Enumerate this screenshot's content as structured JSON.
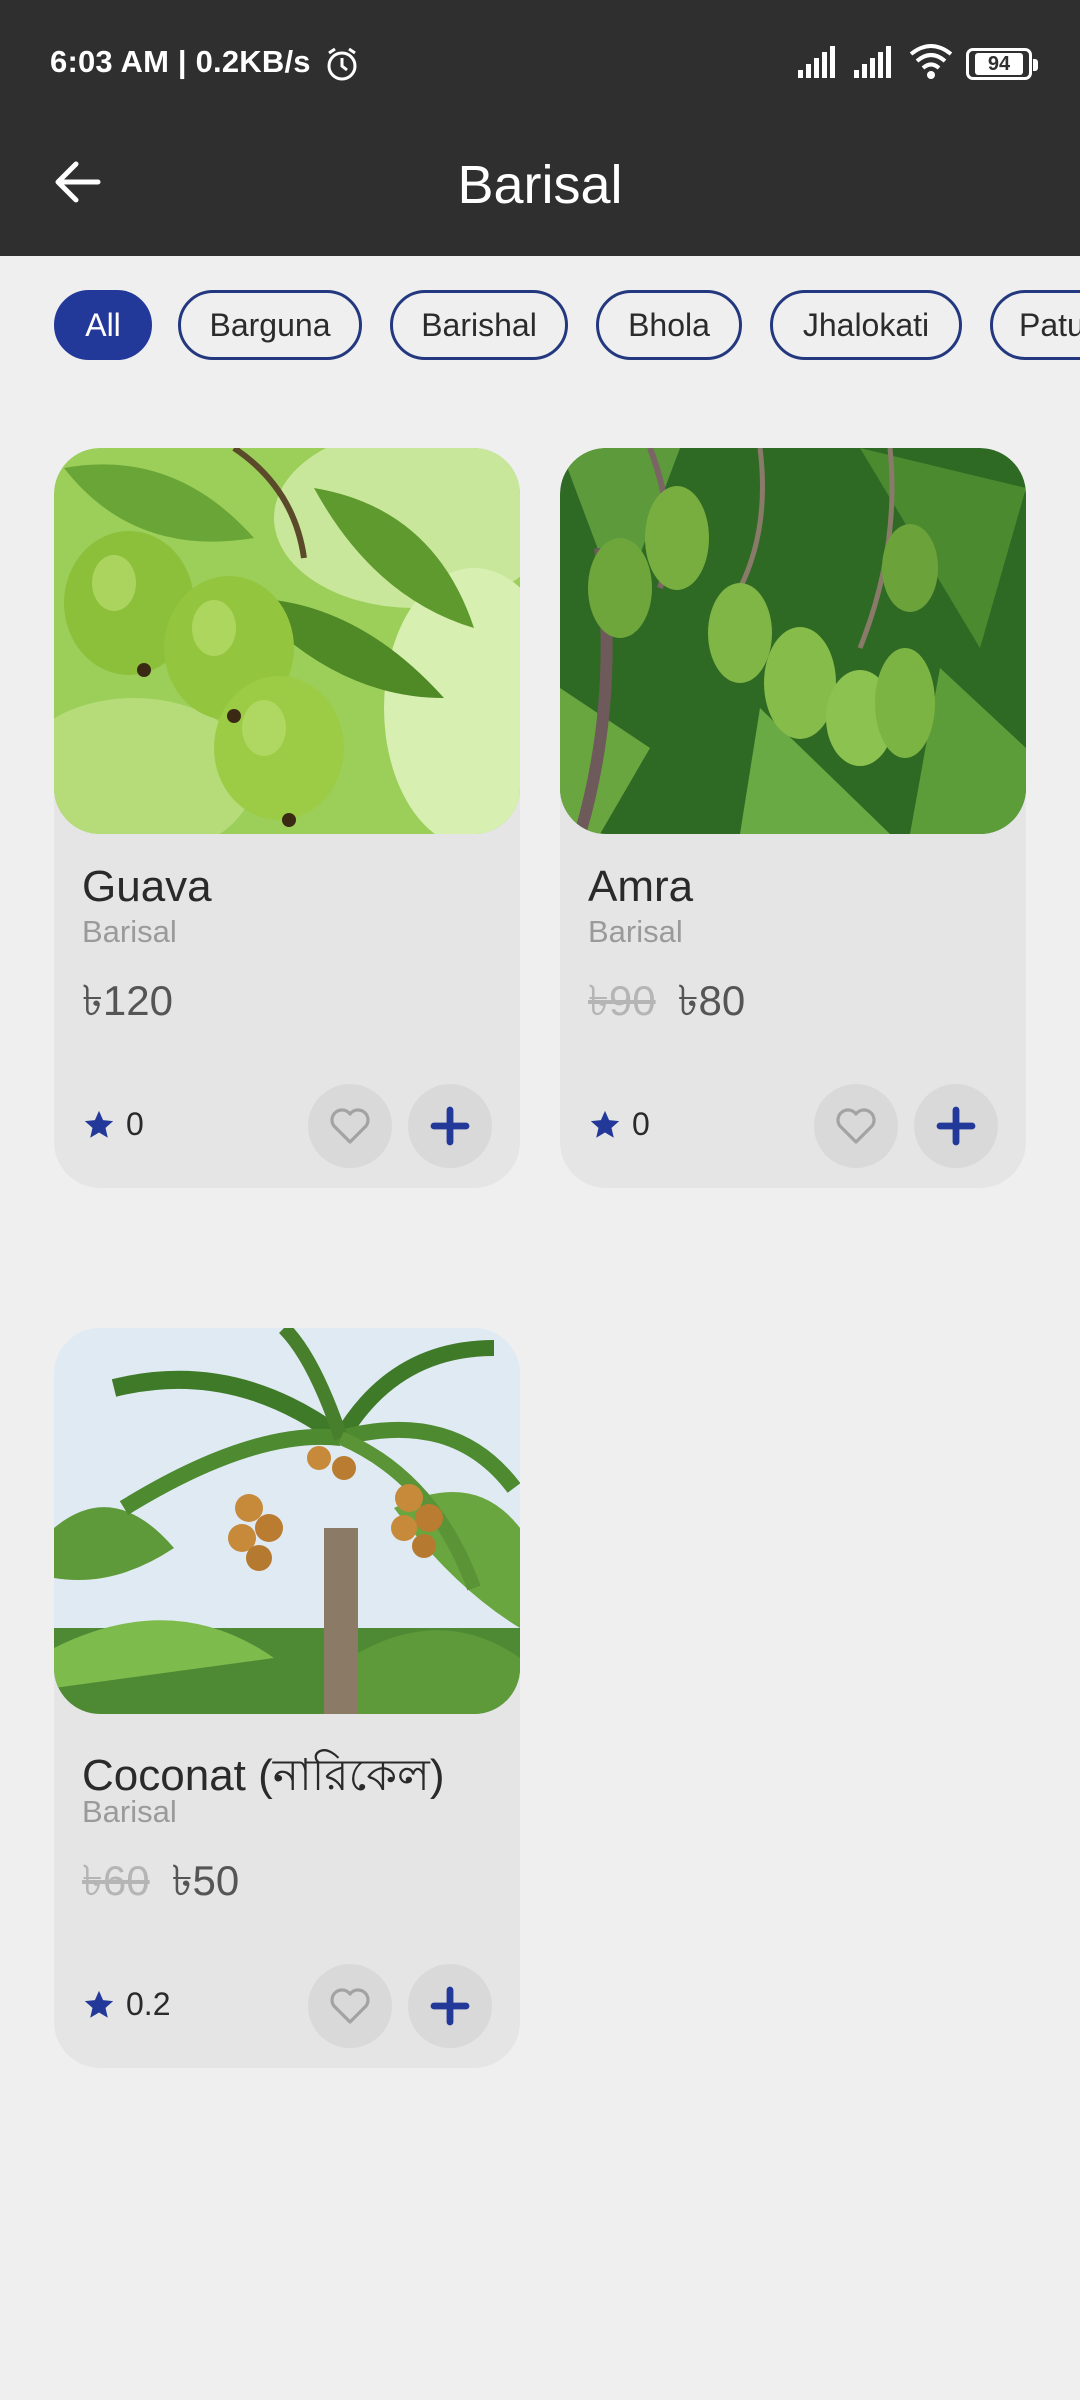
{
  "status_bar": {
    "time_speed": "6:03 AM | 0.2KB/s",
    "battery": "94"
  },
  "app_bar": {
    "title": "Barisal"
  },
  "filters": [
    "All",
    "Barguna",
    "Barishal",
    "Bhola",
    "Jhalokati",
    "Patu"
  ],
  "active_filter": "All",
  "products": [
    {
      "name": "Guava",
      "location": "Barisal",
      "old_price": "",
      "price": "৳120",
      "rating": "0",
      "image": "guava"
    },
    {
      "name": "Amra",
      "location": "Barisal",
      "old_price": "৳90",
      "price": "৳80",
      "rating": "0",
      "image": "amra"
    },
    {
      "name": "Coconat (নারিকেল)",
      "location": "Barisal",
      "old_price": "৳60",
      "price": "৳50",
      "rating": "0.2",
      "image": "coconut-tree"
    }
  ],
  "colors": {
    "accent": "#23399a",
    "topbar": "#2f2f2f",
    "background": "#efefef",
    "card": "#e5e5e5"
  }
}
